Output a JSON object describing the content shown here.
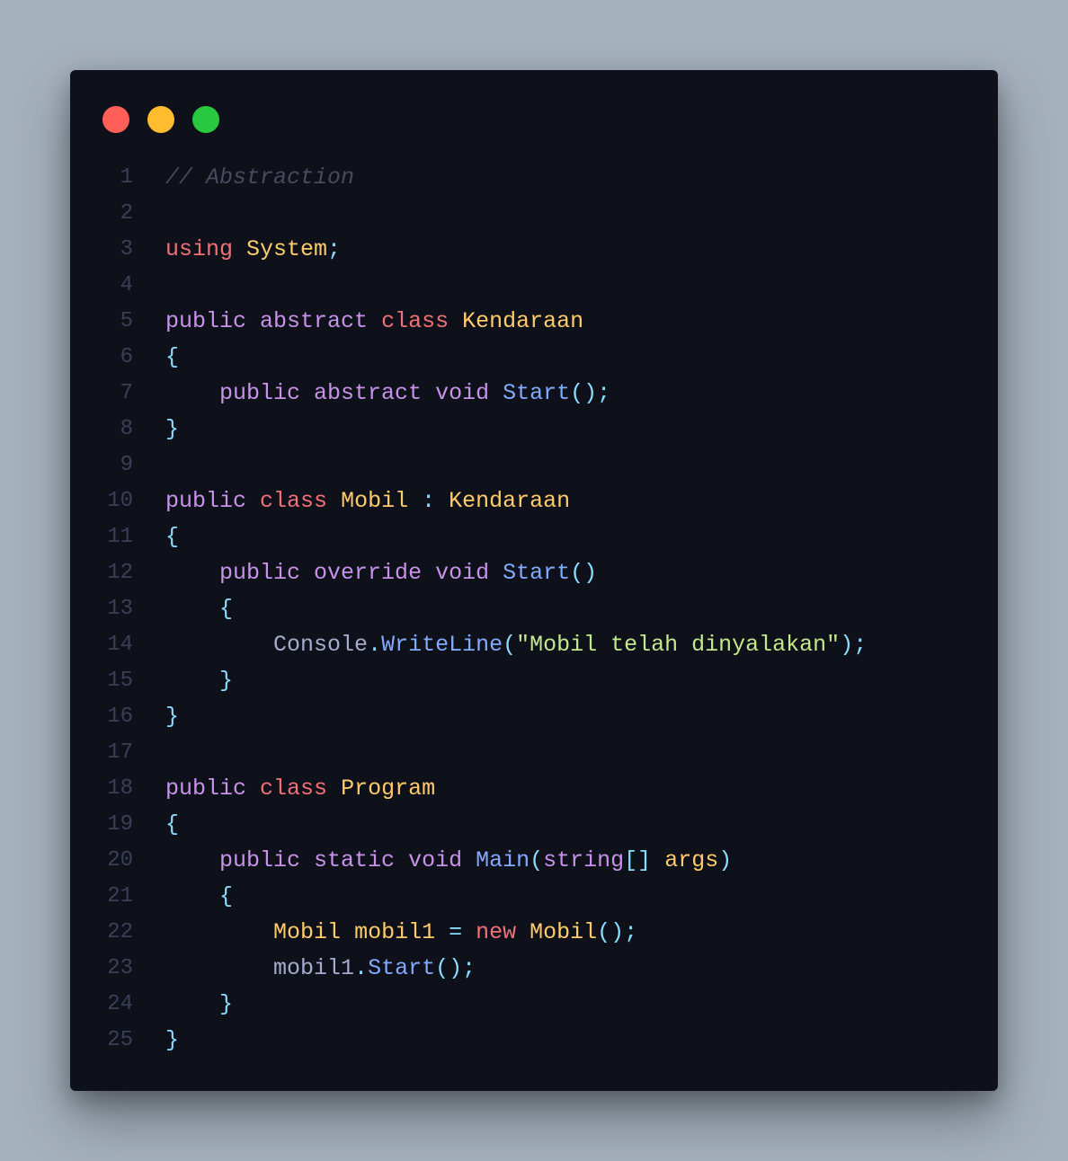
{
  "window": {
    "controls": [
      {
        "name": "close",
        "color": "#ff5f57"
      },
      {
        "name": "minimize",
        "color": "#febc2e"
      },
      {
        "name": "maximize",
        "color": "#28c840"
      }
    ]
  },
  "editor": {
    "language": "csharp",
    "lines": [
      {
        "n": "1",
        "tokens": [
          {
            "t": "// Abstraction",
            "c": "comment"
          }
        ]
      },
      {
        "n": "2",
        "tokens": []
      },
      {
        "n": "3",
        "tokens": [
          {
            "t": "using",
            "c": "keyword"
          },
          {
            "t": " ",
            "c": "plain"
          },
          {
            "t": "System",
            "c": "type"
          },
          {
            "t": ";",
            "c": "punct"
          }
        ]
      },
      {
        "n": "4",
        "tokens": []
      },
      {
        "n": "5",
        "tokens": [
          {
            "t": "public",
            "c": "modifier"
          },
          {
            "t": " ",
            "c": "plain"
          },
          {
            "t": "abstract",
            "c": "modifier"
          },
          {
            "t": " ",
            "c": "plain"
          },
          {
            "t": "class",
            "c": "keyword"
          },
          {
            "t": " ",
            "c": "plain"
          },
          {
            "t": "Kendaraan",
            "c": "type"
          }
        ]
      },
      {
        "n": "6",
        "tokens": [
          {
            "t": "{",
            "c": "punct"
          }
        ]
      },
      {
        "n": "7",
        "tokens": [
          {
            "t": "    ",
            "c": "plain"
          },
          {
            "t": "public",
            "c": "modifier"
          },
          {
            "t": " ",
            "c": "plain"
          },
          {
            "t": "abstract",
            "c": "modifier"
          },
          {
            "t": " ",
            "c": "plain"
          },
          {
            "t": "void",
            "c": "modifier"
          },
          {
            "t": " ",
            "c": "plain"
          },
          {
            "t": "Start",
            "c": "func"
          },
          {
            "t": "();",
            "c": "punct"
          }
        ]
      },
      {
        "n": "8",
        "tokens": [
          {
            "t": "}",
            "c": "punct"
          }
        ]
      },
      {
        "n": "9",
        "tokens": []
      },
      {
        "n": "10",
        "tokens": [
          {
            "t": "public",
            "c": "modifier"
          },
          {
            "t": " ",
            "c": "plain"
          },
          {
            "t": "class",
            "c": "keyword"
          },
          {
            "t": " ",
            "c": "plain"
          },
          {
            "t": "Mobil",
            "c": "type"
          },
          {
            "t": " ",
            "c": "plain"
          },
          {
            "t": ":",
            "c": "punct"
          },
          {
            "t": " ",
            "c": "plain"
          },
          {
            "t": "Kendaraan",
            "c": "type"
          }
        ]
      },
      {
        "n": "11",
        "tokens": [
          {
            "t": "{",
            "c": "punct"
          }
        ]
      },
      {
        "n": "12",
        "tokens": [
          {
            "t": "    ",
            "c": "plain"
          },
          {
            "t": "public",
            "c": "modifier"
          },
          {
            "t": " ",
            "c": "plain"
          },
          {
            "t": "override",
            "c": "modifier"
          },
          {
            "t": " ",
            "c": "plain"
          },
          {
            "t": "void",
            "c": "modifier"
          },
          {
            "t": " ",
            "c": "plain"
          },
          {
            "t": "Start",
            "c": "func"
          },
          {
            "t": "()",
            "c": "punct"
          }
        ]
      },
      {
        "n": "13",
        "tokens": [
          {
            "t": "    ",
            "c": "plain"
          },
          {
            "t": "{",
            "c": "punct"
          }
        ]
      },
      {
        "n": "14",
        "tokens": [
          {
            "t": "        ",
            "c": "plain"
          },
          {
            "t": "Console",
            "c": "ident"
          },
          {
            "t": ".",
            "c": "punct"
          },
          {
            "t": "WriteLine",
            "c": "func"
          },
          {
            "t": "(",
            "c": "punct"
          },
          {
            "t": "\"Mobil telah dinyalakan\"",
            "c": "string"
          },
          {
            "t": ");",
            "c": "punct"
          }
        ]
      },
      {
        "n": "15",
        "tokens": [
          {
            "t": "    ",
            "c": "plain"
          },
          {
            "t": "}",
            "c": "punct"
          }
        ]
      },
      {
        "n": "16",
        "tokens": [
          {
            "t": "}",
            "c": "punct"
          }
        ]
      },
      {
        "n": "17",
        "tokens": []
      },
      {
        "n": "18",
        "tokens": [
          {
            "t": "public",
            "c": "modifier"
          },
          {
            "t": " ",
            "c": "plain"
          },
          {
            "t": "class",
            "c": "keyword"
          },
          {
            "t": " ",
            "c": "plain"
          },
          {
            "t": "Program",
            "c": "type"
          }
        ]
      },
      {
        "n": "19",
        "tokens": [
          {
            "t": "{",
            "c": "punct"
          }
        ]
      },
      {
        "n": "20",
        "tokens": [
          {
            "t": "    ",
            "c": "plain"
          },
          {
            "t": "public",
            "c": "modifier"
          },
          {
            "t": " ",
            "c": "plain"
          },
          {
            "t": "static",
            "c": "modifier"
          },
          {
            "t": " ",
            "c": "plain"
          },
          {
            "t": "void",
            "c": "modifier"
          },
          {
            "t": " ",
            "c": "plain"
          },
          {
            "t": "Main",
            "c": "func"
          },
          {
            "t": "(",
            "c": "punct"
          },
          {
            "t": "string",
            "c": "builtin"
          },
          {
            "t": "[]",
            "c": "punct"
          },
          {
            "t": " ",
            "c": "plain"
          },
          {
            "t": "args",
            "c": "type"
          },
          {
            "t": ")",
            "c": "punct"
          }
        ]
      },
      {
        "n": "21",
        "tokens": [
          {
            "t": "    ",
            "c": "plain"
          },
          {
            "t": "{",
            "c": "punct"
          }
        ]
      },
      {
        "n": "22",
        "tokens": [
          {
            "t": "        ",
            "c": "plain"
          },
          {
            "t": "Mobil",
            "c": "type"
          },
          {
            "t": " ",
            "c": "plain"
          },
          {
            "t": "mobil1",
            "c": "type"
          },
          {
            "t": " ",
            "c": "plain"
          },
          {
            "t": "=",
            "c": "punct"
          },
          {
            "t": " ",
            "c": "plain"
          },
          {
            "t": "new",
            "c": "keyword"
          },
          {
            "t": " ",
            "c": "plain"
          },
          {
            "t": "Mobil",
            "c": "type"
          },
          {
            "t": "();",
            "c": "punct"
          }
        ]
      },
      {
        "n": "23",
        "tokens": [
          {
            "t": "        ",
            "c": "plain"
          },
          {
            "t": "mobil1",
            "c": "ident"
          },
          {
            "t": ".",
            "c": "punct"
          },
          {
            "t": "Start",
            "c": "func"
          },
          {
            "t": "();",
            "c": "punct"
          }
        ]
      },
      {
        "n": "24",
        "tokens": [
          {
            "t": "    ",
            "c": "plain"
          },
          {
            "t": "}",
            "c": "punct"
          }
        ]
      },
      {
        "n": "25",
        "tokens": [
          {
            "t": "}",
            "c": "punct"
          }
        ]
      }
    ]
  }
}
